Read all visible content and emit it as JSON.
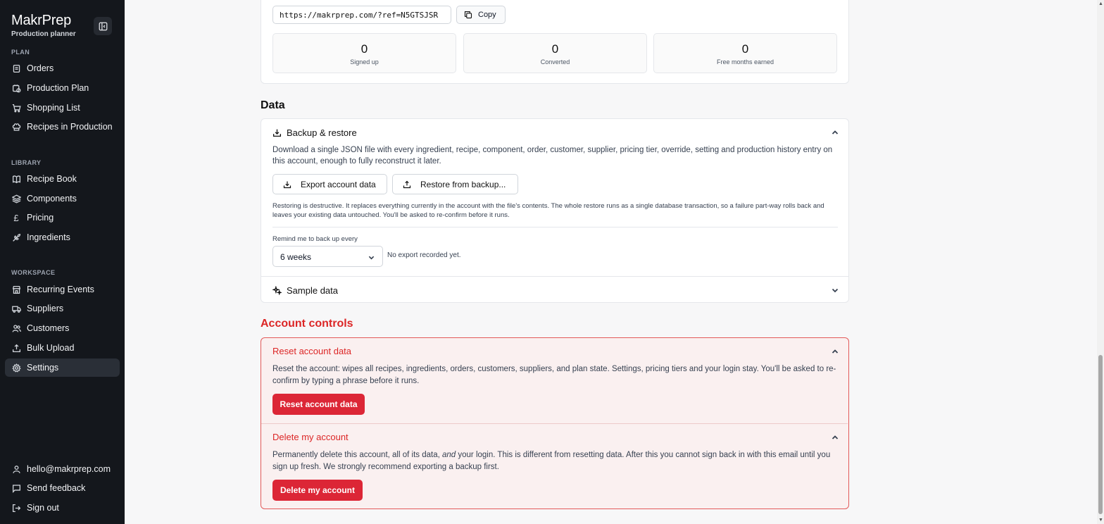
{
  "brand": {
    "name": "MakrPrep",
    "subtitle": "Production planner"
  },
  "sidebar": {
    "sections": {
      "plan": "PLAN",
      "library": "LIBRARY",
      "workspace": "WORKSPACE"
    },
    "plan_items": [
      {
        "label": "Orders",
        "icon": "orders-icon"
      },
      {
        "label": "Production Plan",
        "icon": "calendar-clock-icon"
      },
      {
        "label": "Shopping List",
        "icon": "cart-icon"
      },
      {
        "label": "Recipes in Production",
        "icon": "chef-hat-icon"
      }
    ],
    "library_items": [
      {
        "label": "Recipe Book",
        "icon": "book-icon"
      },
      {
        "label": "Components",
        "icon": "layers-icon"
      },
      {
        "label": "Pricing",
        "icon": "pound-icon"
      },
      {
        "label": "Ingredients",
        "icon": "wheat-icon"
      }
    ],
    "workspace_items": [
      {
        "label": "Recurring Events",
        "icon": "store-icon"
      },
      {
        "label": "Suppliers",
        "icon": "truck-icon"
      },
      {
        "label": "Customers",
        "icon": "users-icon"
      },
      {
        "label": "Bulk Upload",
        "icon": "upload-icon"
      },
      {
        "label": "Settings",
        "icon": "gear-icon",
        "active": true
      }
    ],
    "footer": {
      "email": "hello@makrprep.com",
      "feedback": "Send feedback",
      "signout": "Sign out"
    }
  },
  "referral": {
    "url": "https://makrprep.com/?ref=N5GTSJSR",
    "copy_label": "Copy",
    "stats": [
      {
        "value": "0",
        "label": "Signed up"
      },
      {
        "value": "0",
        "label": "Converted"
      },
      {
        "value": "0",
        "label": "Free months earned"
      }
    ]
  },
  "data_section": {
    "title": "Data",
    "backup": {
      "title": "Backup & restore",
      "description": "Download a single JSON file with every ingredient, recipe, component, order, customer, supplier, pricing tier, override, setting and production history entry on this account, enough to fully reconstruct it later.",
      "export_label": "Export account data",
      "restore_label": "Restore from backup...",
      "warning": "Restoring is destructive. It replaces everything currently in the account with the file's contents. The whole restore runs as a single database transaction, so a failure part-way rolls back and leaves your existing data untouched. You'll be asked to re-confirm before it runs.",
      "remind_label": "Remind me to back up every",
      "remind_value": "6 weeks",
      "export_status": "No export recorded yet."
    },
    "sample": {
      "title": "Sample data"
    }
  },
  "account_controls": {
    "title": "Account controls",
    "reset": {
      "title": "Reset account data",
      "description": "Reset the account: wipes all recipes, ingredients, orders, customers, suppliers, and plan state. Settings, pricing tiers and your login stay. You'll be asked to re-confirm by typing a phrase before it runs.",
      "button": "Reset account data"
    },
    "delete": {
      "title": "Delete my account",
      "description_before": "Permanently delete this account, all of its data, ",
      "description_em": "and",
      "description_after": " your login. This is different from resetting data. After this you cannot sign back in with this email until you sign up fresh. We strongly recommend exporting a backup first.",
      "button": "Delete my account"
    }
  },
  "colors": {
    "sidebar_bg": "#14171c",
    "danger": "#dc2626",
    "danger_bg": "#faf0f0"
  }
}
